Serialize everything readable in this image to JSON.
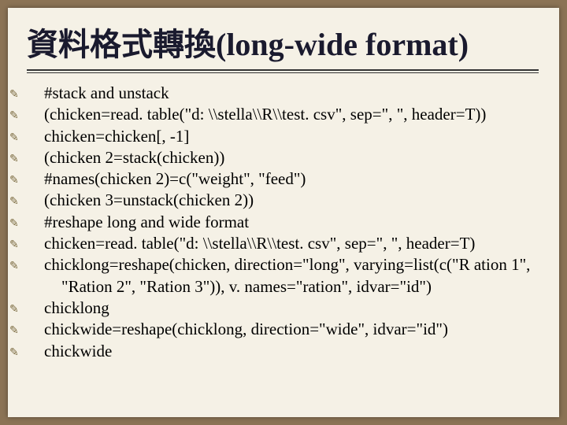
{
  "title": "資料格式轉換(long-wide format)",
  "lines": [
    "#stack and unstack",
    "(chicken=read. table(\"d: \\\\stella\\\\R\\\\test. csv\", sep=\", \", header=T))",
    "chicken=chicken[, -1]",
    "(chicken 2=stack(chicken))",
    "#names(chicken 2)=c(\"weight\", \"feed\")",
    "(chicken 3=unstack(chicken 2))",
    "#reshape long and wide format",
    "chicken=read. table(\"d: \\\\stella\\\\R\\\\test. csv\", sep=\", \", header=T)",
    "chicklong=reshape(chicken, direction=\"long\", varying=list(c(\"R ation 1\", \"Ration 2\", \"Ration 3\")), v. names=\"ration\", idvar=\"id\")",
    "chicklong",
    "chickwide=reshape(chicklong, direction=\"wide\", idvar=\"id\")",
    "chickwide"
  ]
}
